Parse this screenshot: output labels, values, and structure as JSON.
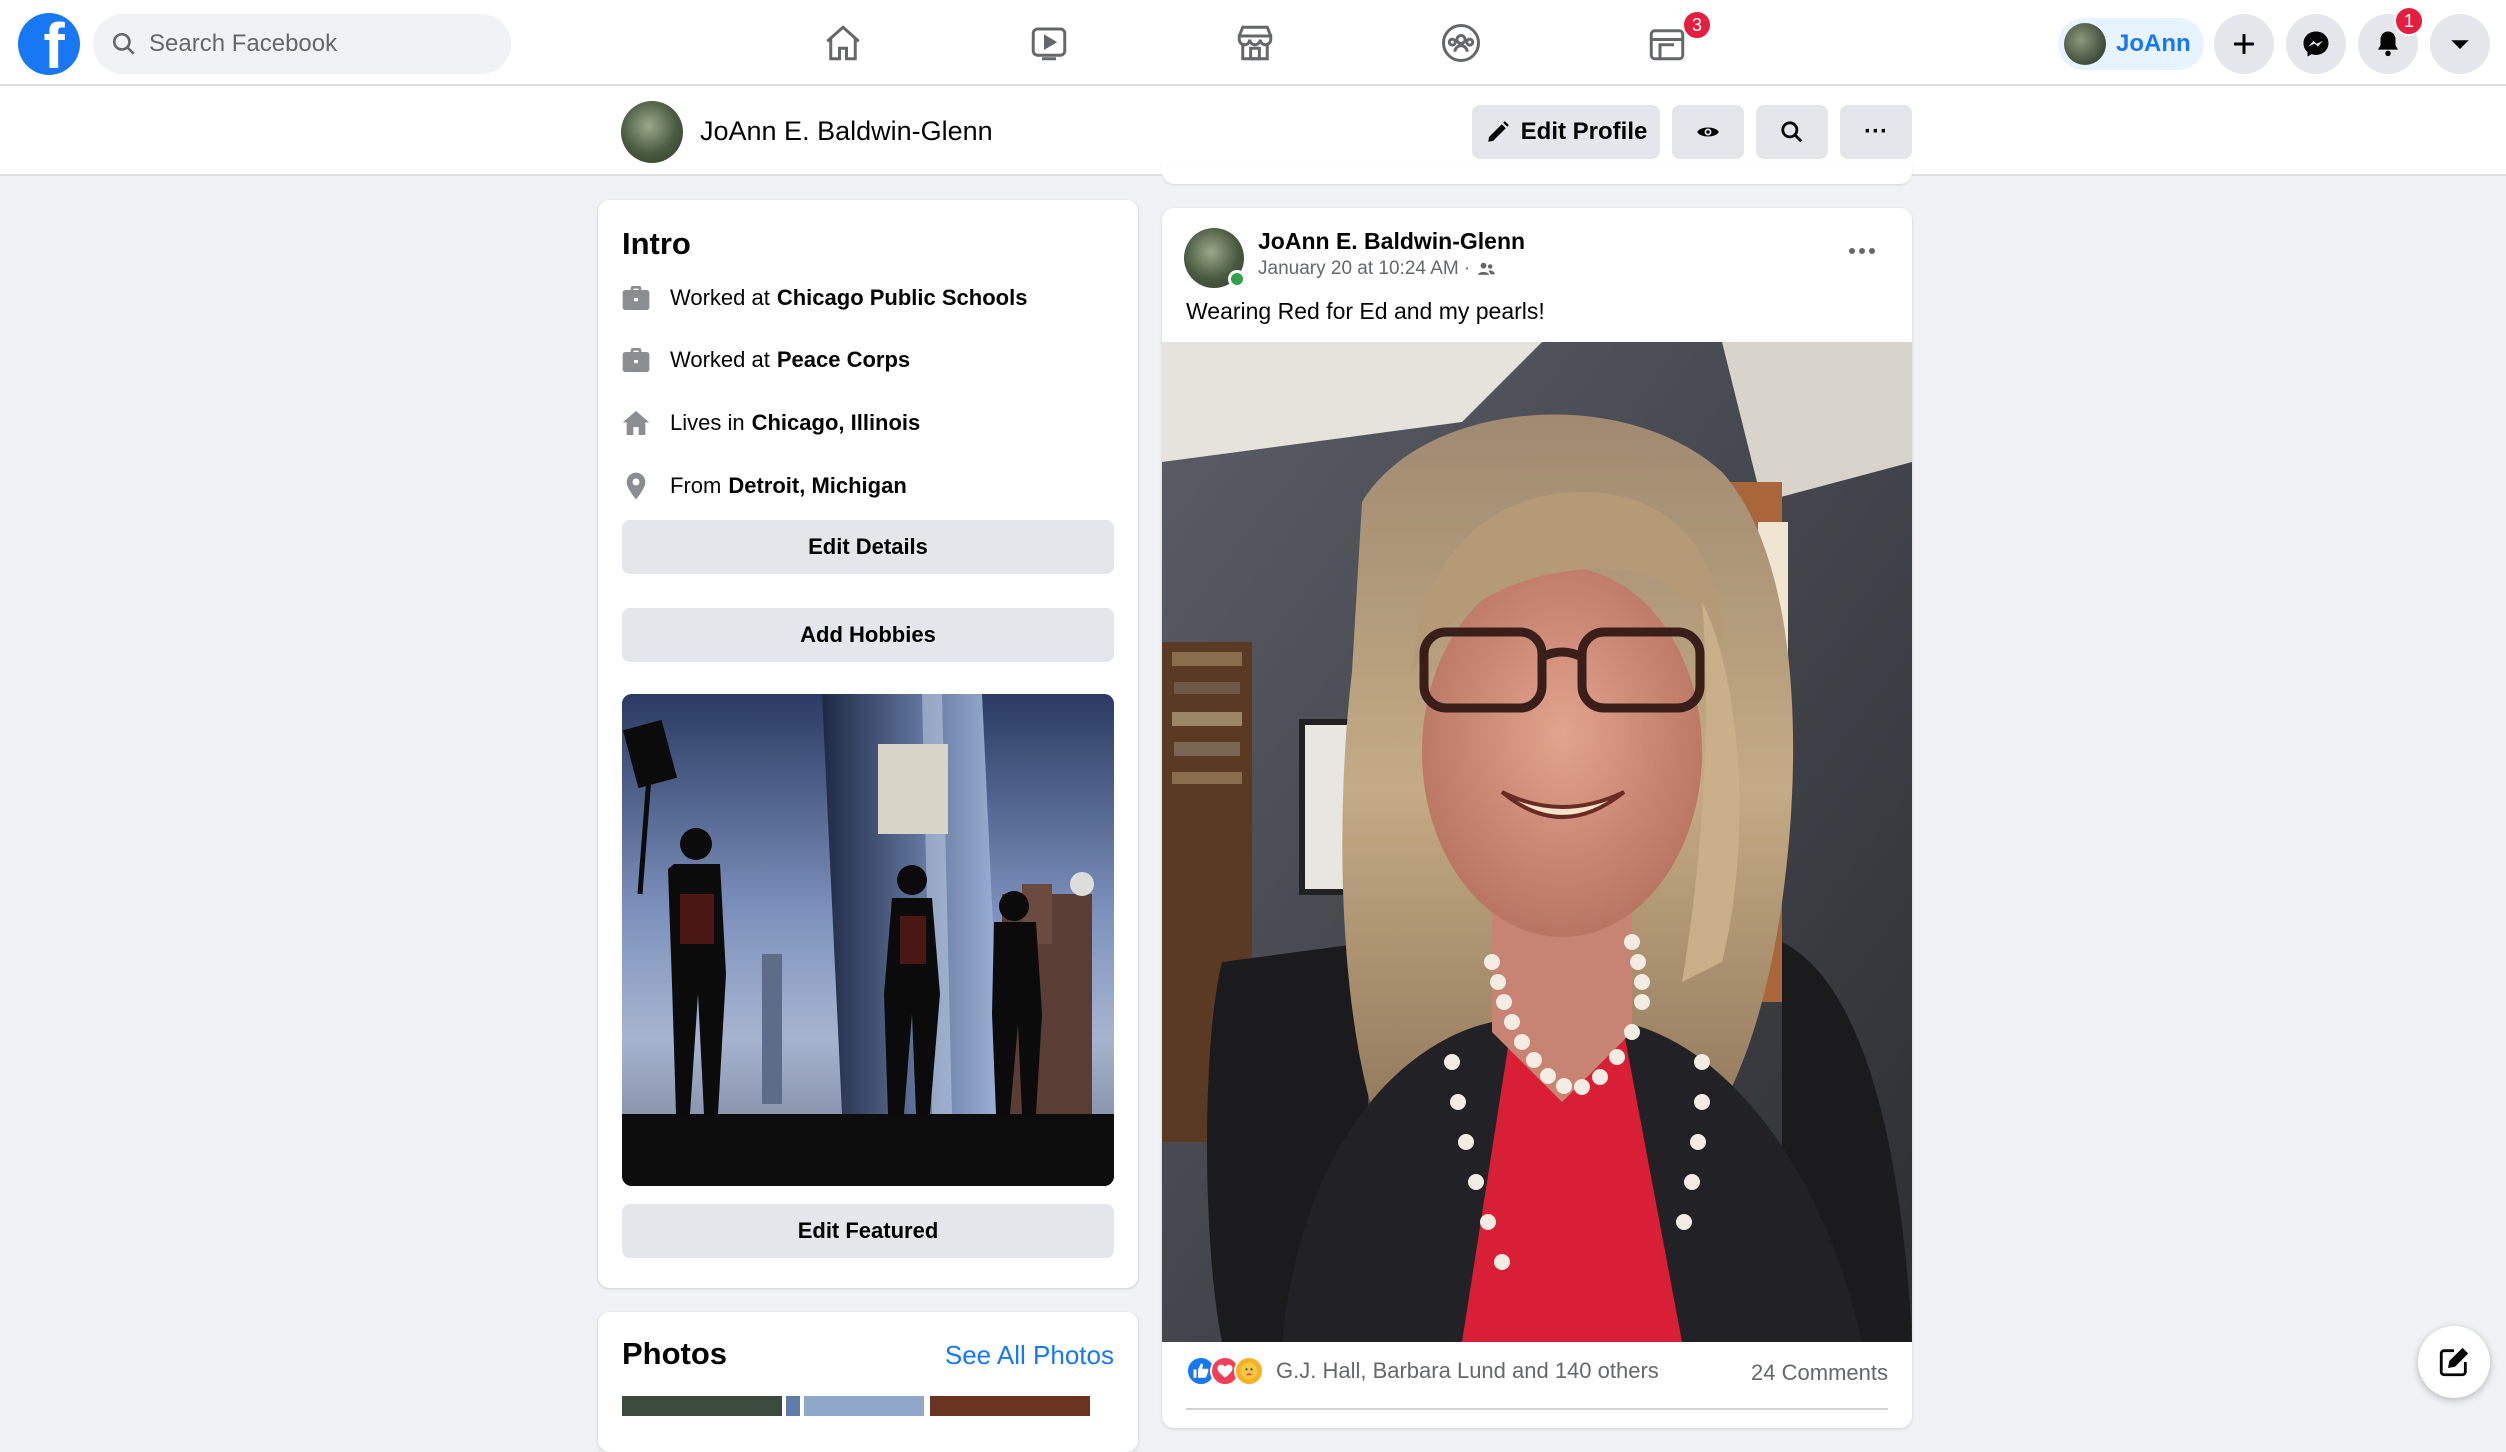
{
  "nav": {
    "logo_letter": "f",
    "search_placeholder": "Search Facebook",
    "tabs": [
      {
        "name": "home-icon"
      },
      {
        "name": "watch-icon"
      },
      {
        "name": "marketplace-icon"
      },
      {
        "name": "groups-icon"
      },
      {
        "name": "gaming-icon",
        "badge": "3"
      }
    ],
    "profile_label": "JoAnn",
    "notifications_badge": "1",
    "accent_color": "#1877f2",
    "badge_color": "#e41e3f"
  },
  "profile_header": {
    "name": "JoAnn E. Baldwin-Glenn",
    "edit_profile_label": "Edit Profile",
    "more_label": "···"
  },
  "intro": {
    "title": "Intro",
    "items": [
      {
        "icon": "briefcase-icon",
        "prefix": "Worked at",
        "value": "Chicago Public Schools"
      },
      {
        "icon": "briefcase-icon",
        "prefix": "Worked at",
        "value": "Peace Corps"
      },
      {
        "icon": "home-icon",
        "prefix": "Lives in",
        "value": "Chicago, Illinois"
      },
      {
        "icon": "location-pin-icon",
        "prefix": "From",
        "value": "Detroit, Michigan"
      }
    ],
    "edit_details_label": "Edit Details",
    "add_hobbies_label": "Add Hobbies",
    "edit_featured_label": "Edit Featured"
  },
  "photos": {
    "title": "Photos",
    "see_all_label": "See All Photos"
  },
  "post": {
    "author": "JoAnn E. Baldwin-Glenn",
    "timestamp": "January 20 at 10:24 AM ·",
    "text": "Wearing Red for Ed and my pearls!",
    "reaction_names": "G.J. Hall, Barbara Lund and 140 others",
    "comments": "24 Comments",
    "more_label": "···"
  }
}
